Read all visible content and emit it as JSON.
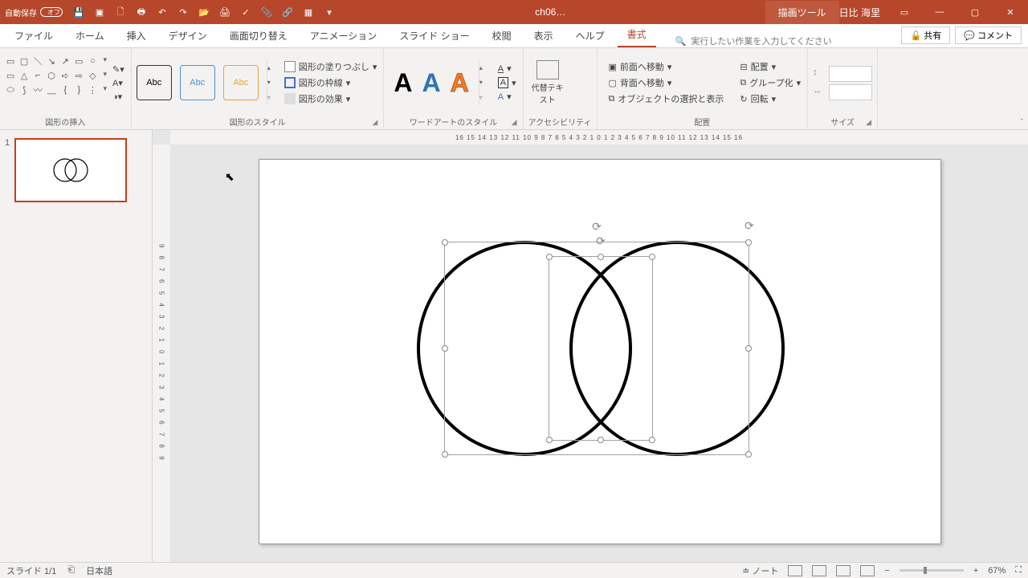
{
  "titlebar": {
    "autosave_label": "自動保存",
    "autosave_state": "オフ",
    "filename": "ch06…",
    "context_tab": "描画ツール",
    "user": "日比 海里"
  },
  "tabs": {
    "file": "ファイル",
    "home": "ホーム",
    "insert": "挿入",
    "design": "デザイン",
    "transitions": "画面切り替え",
    "animations": "アニメーション",
    "slideshow": "スライド ショー",
    "review": "校閲",
    "view": "表示",
    "help": "ヘルプ",
    "format": "書式",
    "tell_me": "実行したい作業を入力してください",
    "share": "共有",
    "comment": "コメント"
  },
  "ribbon": {
    "insert_shapes": "図形の挿入",
    "shape_styles": "図形のスタイル",
    "wordart_styles": "ワードアートのスタイル",
    "accessibility": "アクセシビリティ",
    "arrange": "配置",
    "size": "サイズ",
    "abc": "Abc",
    "shape_fill": "図形の塗りつぶし",
    "shape_outline": "図形の枠線",
    "shape_effects": "図形の効果",
    "alt_text": "代替テキスト",
    "bring_forward": "前面へ移動",
    "send_backward": "背面へ移動",
    "selection_pane": "オブジェクトの選択と表示",
    "align": "配置",
    "group": "グループ化",
    "rotate": "回転",
    "wa_letter": "A"
  },
  "ruler": {
    "h": "16  15  14  13  12  11  10  9  8  7  6  5  4  3  2  1  0  1  2  3  4  5  6  7  8  9  10  11  12  13  14  15  16",
    "v": "9 8 7 6 5 4 3 2 1 0 1 2 3 4 5 6 7 8 9"
  },
  "status": {
    "slide": "スライド 1/1",
    "lang": "日本語",
    "notes": "ノート",
    "zoom": "67%"
  },
  "thumbs": {
    "n1": "1"
  }
}
